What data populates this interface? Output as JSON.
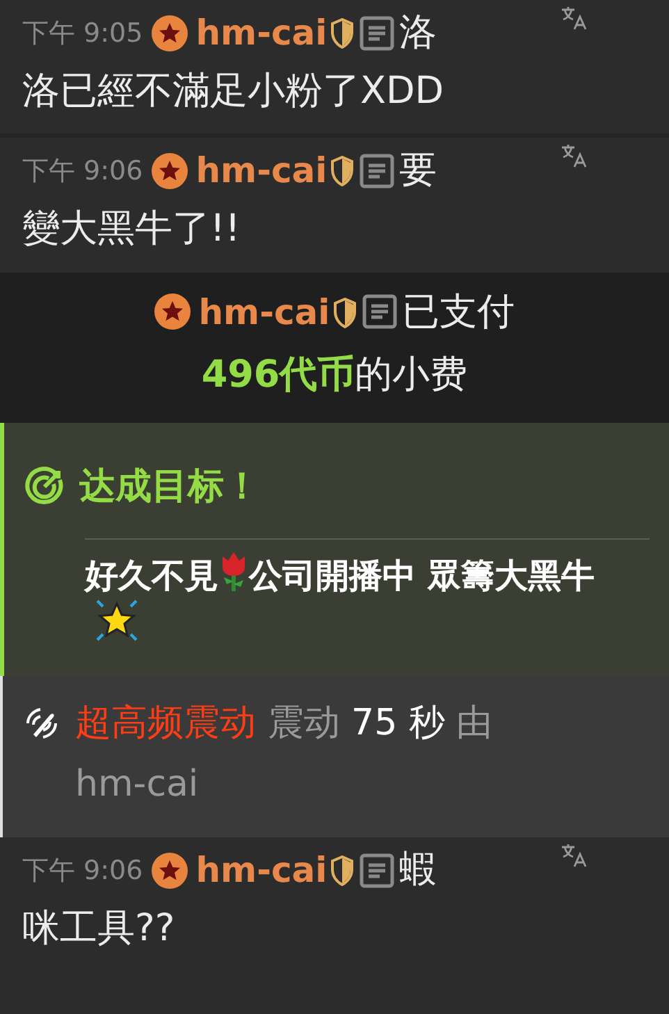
{
  "events": [
    {
      "kind": "message",
      "time": "下午 9:05",
      "user": "hm-cai",
      "text_lines": [
        "洛",
        "洛已經不滿足小粉了XDD"
      ]
    },
    {
      "kind": "message",
      "time": "下午 9:06",
      "user": "hm-cai",
      "text_lines": [
        "要",
        "變大黑牛了!!"
      ]
    },
    {
      "kind": "tip",
      "user": "hm-cai",
      "action": "已支付",
      "amount": "496代币",
      "suffix": "的小费"
    },
    {
      "kind": "goal",
      "title": "达成目标！",
      "text_1": "好久不見",
      "text_2": "公司開播中 眾籌大黑牛"
    },
    {
      "kind": "vibration",
      "level_name": "超高频震动",
      "verb": "震动",
      "duration": "75 秒",
      "by": "由",
      "user": "hm-cai"
    },
    {
      "kind": "message",
      "time": "下午 9:06",
      "user": "hm-cai",
      "text_lines": [
        "蝦",
        "咪工具??"
      ]
    }
  ]
}
